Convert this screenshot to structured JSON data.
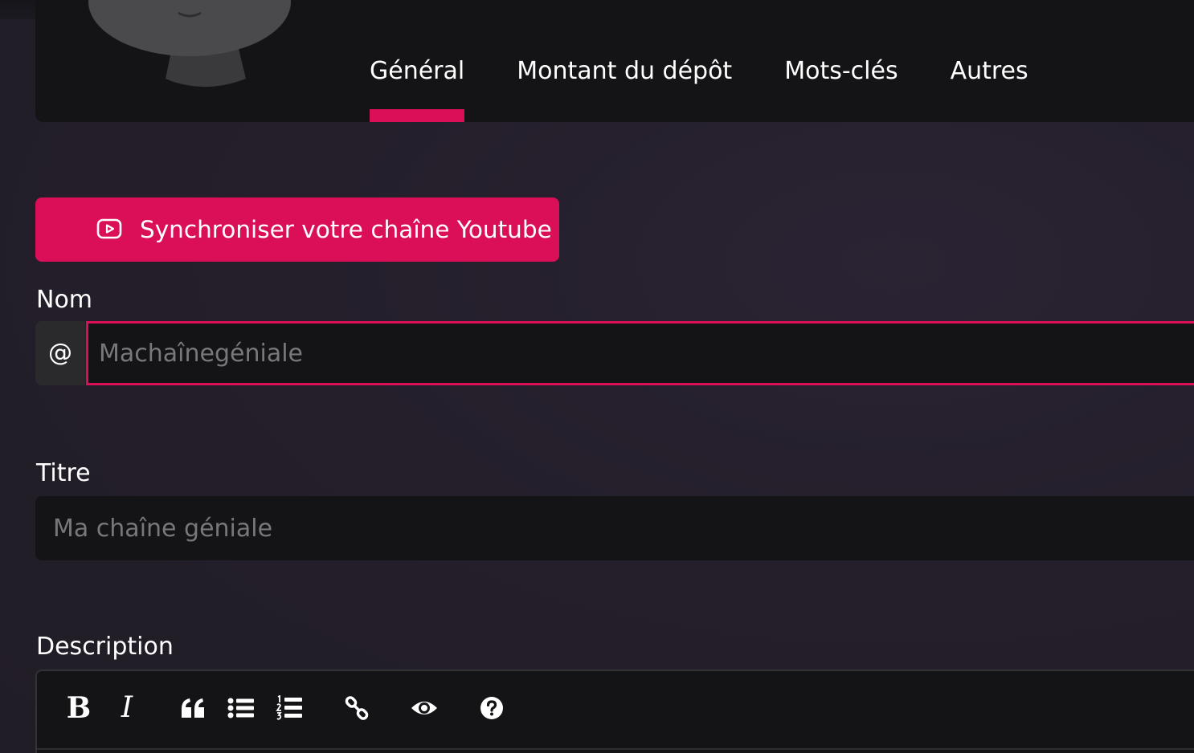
{
  "tabs": [
    {
      "label": "Général",
      "active": true
    },
    {
      "label": "Montant du dépôt",
      "active": false
    },
    {
      "label": "Mots-clés",
      "active": false
    },
    {
      "label": "Autres",
      "active": false
    }
  ],
  "sync_button": {
    "label": "Synchroniser votre chaîne Youtube",
    "icon": "youtube-play-icon"
  },
  "form": {
    "nom": {
      "label": "Nom",
      "prefix": "@",
      "placeholder": "Machaînegéniale",
      "value": ""
    },
    "titre": {
      "label": "Titre",
      "placeholder": "Ma chaîne géniale",
      "value": ""
    },
    "description": {
      "label": "Description"
    }
  },
  "editor_toolbar": {
    "bold_glyph": "B",
    "italic_glyph": "I",
    "icons": [
      "bold-icon",
      "italic-icon",
      "quote-icon",
      "unordered-list-icon",
      "ordered-list-icon",
      "link-icon",
      "preview-eye-icon",
      "help-icon"
    ]
  },
  "colors": {
    "accent": "#db0e58",
    "card": "#141416",
    "background": "#231f29"
  }
}
